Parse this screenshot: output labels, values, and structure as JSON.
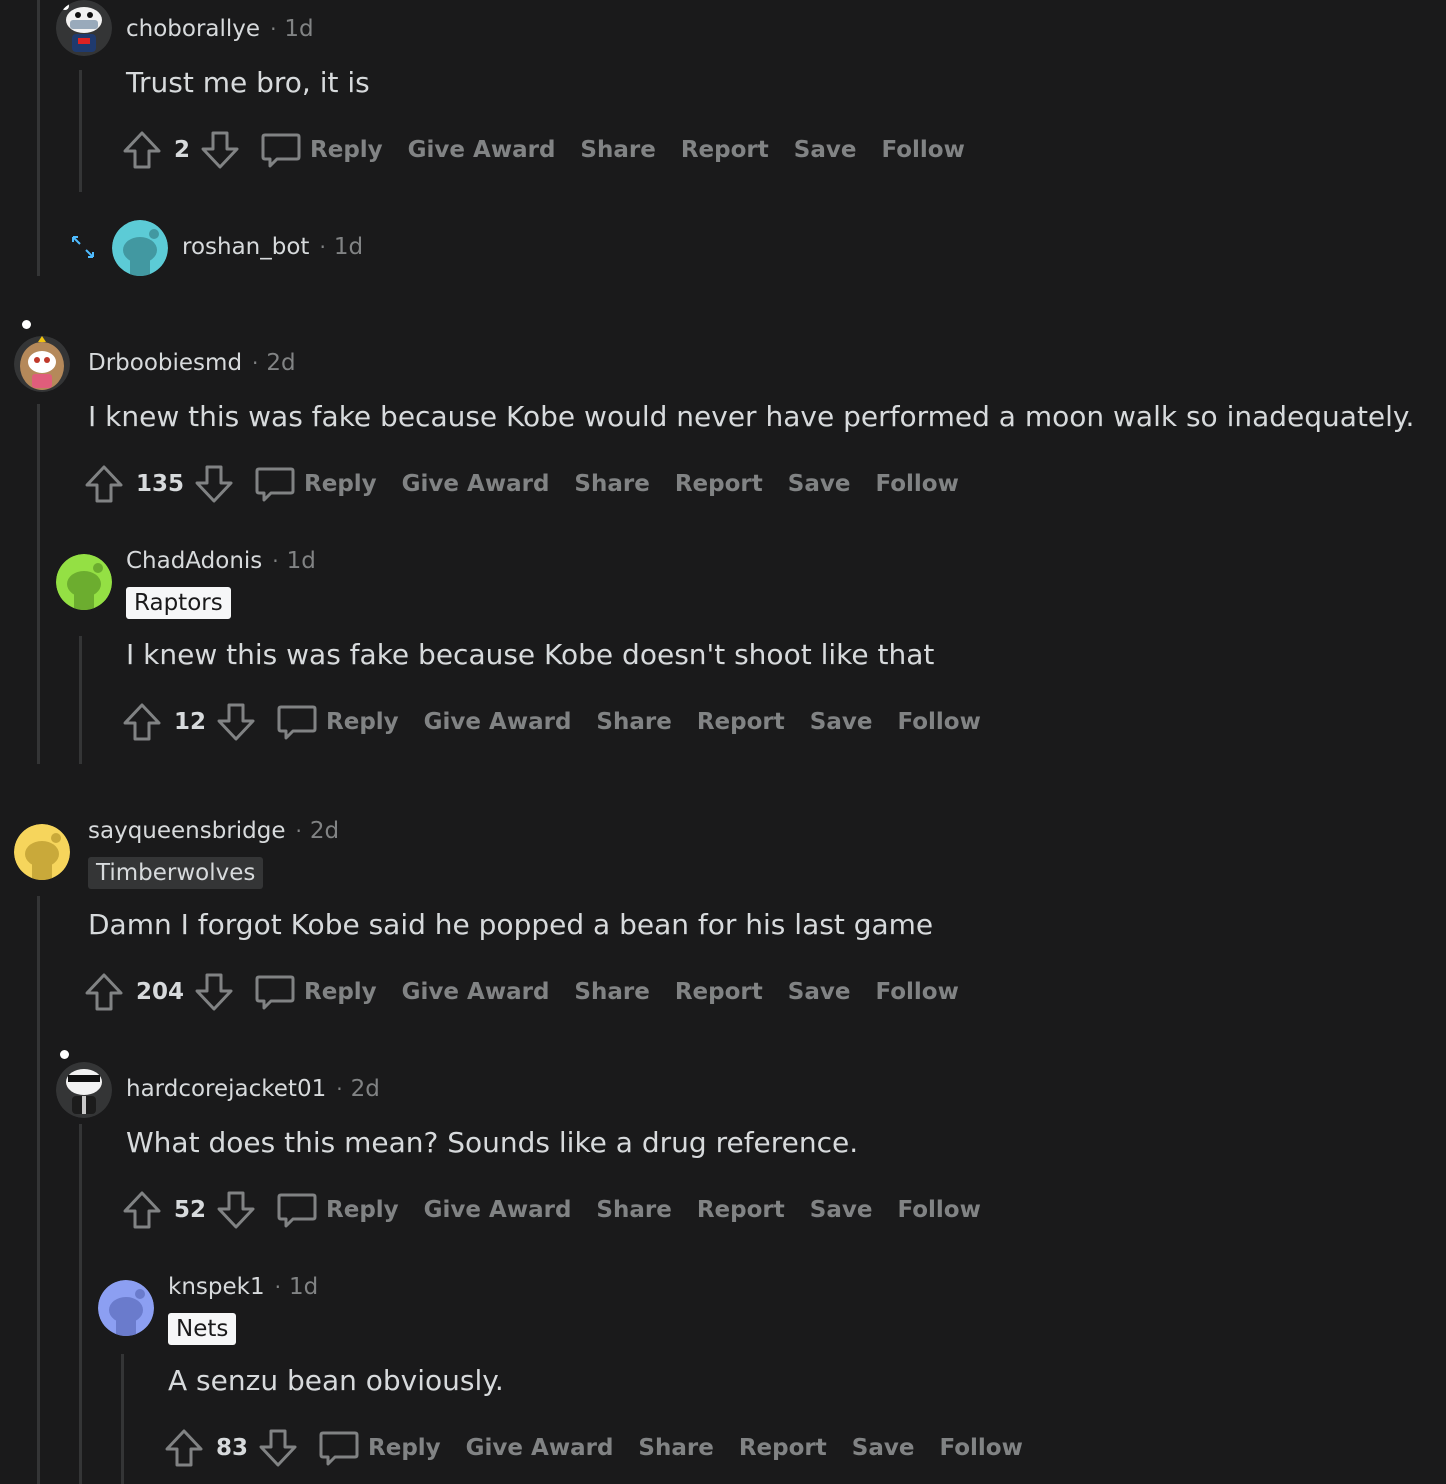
{
  "actions": {
    "reply": "Reply",
    "give_award": "Give Award",
    "share": "Share",
    "report": "Report",
    "save": "Save",
    "follow": "Follow"
  },
  "comments": [
    {
      "username": "choborallye",
      "sep": "·",
      "age": "1d",
      "body": "Trust me bro, it is",
      "score": "2",
      "avatar": "snoo-masked"
    },
    {
      "username": "roshan_bot",
      "sep": "·",
      "age": "1d",
      "collapsed": true,
      "avatar": "snoo-teal"
    },
    {
      "username": "Drboobiesmd",
      "sep": "·",
      "age": "2d",
      "body": "I knew this was fake because Kobe would never have performed a moon walk so inadequately.",
      "score": "135",
      "avatar": "snoo-costume"
    },
    {
      "username": "ChadAdonis",
      "sep": "·",
      "age": "1d",
      "flair": "Raptors",
      "body": "I knew this was fake because Kobe doesn't shoot like that",
      "score": "12",
      "avatar": "snoo-green"
    },
    {
      "username": "sayqueensbridge",
      "sep": "·",
      "age": "2d",
      "flair": "Timberwolves",
      "body": "Damn I forgot Kobe said he popped a bean for his last game",
      "score": "204",
      "avatar": "snoo-yellow"
    },
    {
      "username": "hardcorejacket01",
      "sep": "·",
      "age": "2d",
      "body": "What does this mean? Sounds like a drug reference.",
      "score": "52",
      "avatar": "snoo-sunglasses"
    },
    {
      "username": "knspek1",
      "sep": "·",
      "age": "1d",
      "flair": "Nets",
      "body": "A senzu bean obviously.",
      "score": "83",
      "avatar": "snoo-periwinkle"
    }
  ],
  "colors": {
    "background": "#1a1a1b",
    "text": "#d7dadc",
    "muted": "#818384",
    "thread_line": "#343536",
    "expand_accent": "#4fbcff"
  }
}
